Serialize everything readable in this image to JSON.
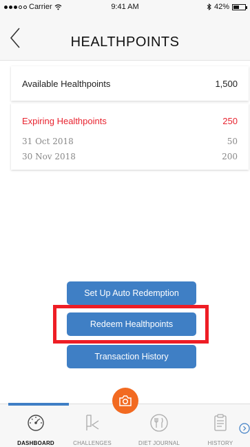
{
  "status": {
    "carrier": "Carrier",
    "time": "9:41 AM",
    "battery": "42%"
  },
  "header": {
    "title": "HEALTHPOINTS"
  },
  "available": {
    "label": "Available Healthpoints",
    "value": "1,500"
  },
  "expiring": {
    "label": "Expiring Healthpoints",
    "value": "250",
    "items": [
      {
        "date": "31 Oct 2018",
        "points": "50"
      },
      {
        "date": "30 Nov 2018",
        "points": "200"
      }
    ]
  },
  "actions": {
    "auto_redeem": "Set Up Auto Redemption",
    "redeem": "Redeem Healthpoints",
    "history": "Transaction History"
  },
  "tabs": [
    {
      "label": "DASHBOARD",
      "icon": "dashboard-icon",
      "active": true
    },
    {
      "label": "CHALLENGES",
      "icon": "challenges-icon",
      "active": false
    },
    {
      "label": "DIET JOURNAL",
      "icon": "diet-journal-icon",
      "active": false
    },
    {
      "label": "HISTORY",
      "icon": "history-icon",
      "active": false
    }
  ],
  "colors": {
    "accent": "#3f7fc5",
    "warning": "#e8232f",
    "camera": "#f26a21",
    "highlight": "#ee1d25"
  }
}
